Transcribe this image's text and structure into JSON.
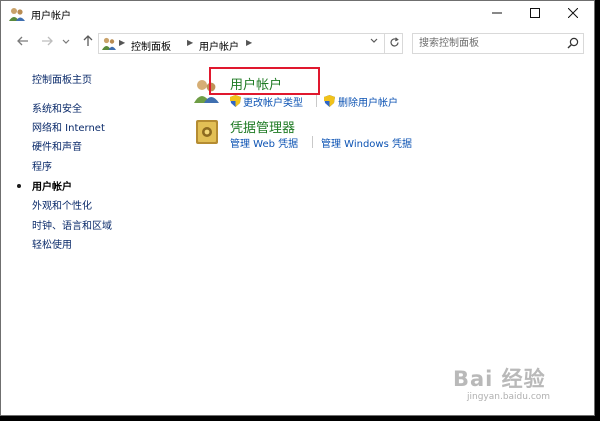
{
  "window": {
    "title": "用户帐户"
  },
  "address": {
    "crumbs": [
      "控制面板",
      "用户帐户"
    ]
  },
  "search": {
    "placeholder": "搜索控制面板"
  },
  "sidebar": {
    "home": "控制面板主页",
    "items": [
      {
        "label": "系统和安全"
      },
      {
        "label": "网络和 Internet"
      },
      {
        "label": "硬件和声音"
      },
      {
        "label": "程序"
      },
      {
        "label": "用户帐户",
        "current": true
      },
      {
        "label": "外观和个性化"
      },
      {
        "label": "时钟、语言和区域"
      },
      {
        "label": "轻松使用"
      }
    ]
  },
  "main": {
    "categories": [
      {
        "title": "用户帐户",
        "tasks": [
          "更改帐户类型",
          "删除用户帐户"
        ]
      },
      {
        "title": "凭据管理器",
        "tasks": [
          "管理 Web 凭据",
          "管理 Windows 凭据"
        ]
      }
    ]
  },
  "watermark": {
    "main": "Bai 经验",
    "sub": "jingyan.baidu.com"
  },
  "colors": {
    "link": "#0b52b3",
    "category_title": "#1e7a23",
    "highlight": "#e0182e",
    "sidebar_link": "#0a2a6a"
  }
}
